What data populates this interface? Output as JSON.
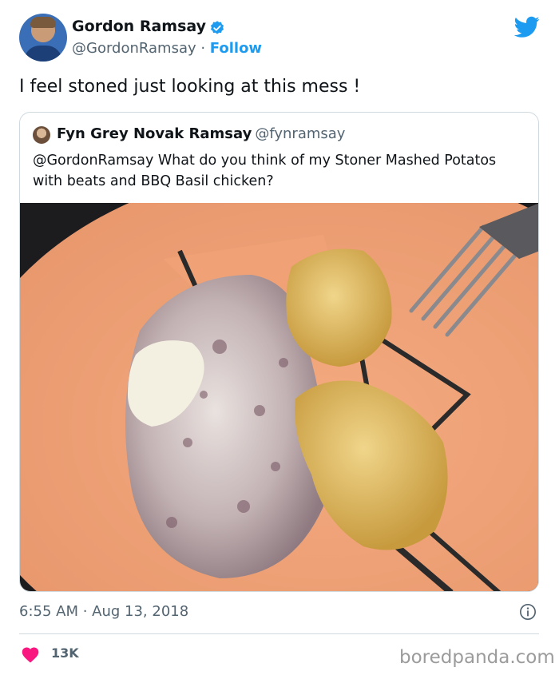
{
  "author": {
    "display_name": "Gordon Ramsay",
    "handle_line": "@GordonRamsay · ",
    "follow_label": "Follow",
    "verified": true
  },
  "tweet": {
    "text": "I feel stoned just looking at this mess !"
  },
  "quoted_tweet": {
    "display_name": "Fyn Grey Novak Ramsay",
    "handle": "@fynramsay",
    "text": "@GordonRamsay What do you think of my Stoner Mashed Potatos with beats and BBQ Basil chicken?"
  },
  "meta": {
    "timestamp": "6:55 AM · Aug 13, 2018",
    "likes": "13K"
  },
  "watermark": "boredpanda.com",
  "colors": {
    "accent": "#1d9bf0",
    "heart": "#f91880",
    "plate": "#f0a176"
  },
  "icons": [
    "verified-badge-icon",
    "twitter-bird-icon",
    "info-icon",
    "heart-icon"
  ]
}
